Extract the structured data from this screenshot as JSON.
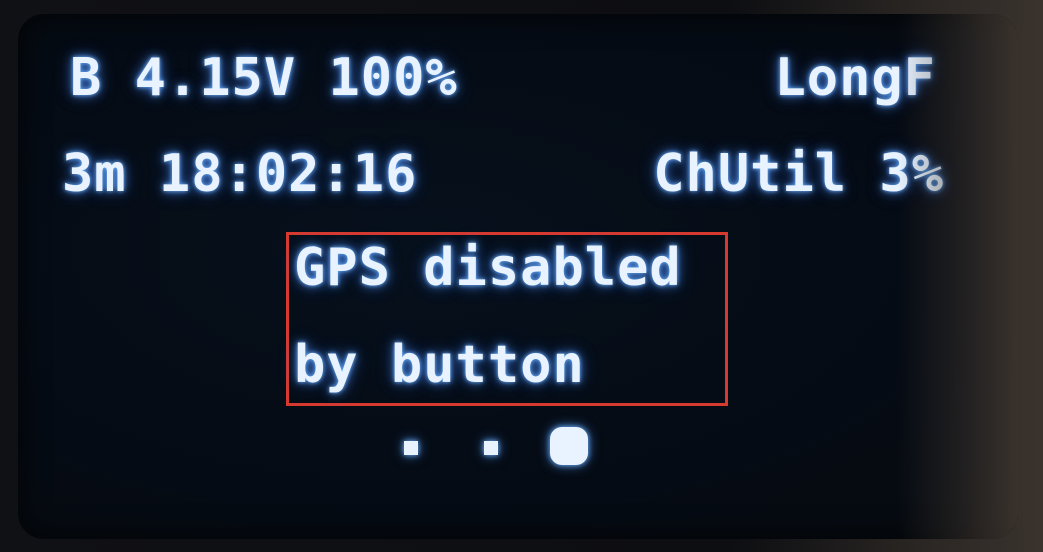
{
  "status": {
    "battery": "B 4.15V 100%",
    "mode": "LongF",
    "uptime": "3m 18:02:16",
    "channel_util": "ChUtil 3%"
  },
  "message": {
    "line1": "GPS disabled",
    "line2": "by button",
    "highlight_color": "#d63a2f"
  },
  "pager": {
    "count": 3,
    "active_index": 2
  },
  "colors": {
    "oled_text": "#e8f3ff",
    "oled_glow": "#6fb6ff",
    "screen_bg": "#050b14"
  }
}
